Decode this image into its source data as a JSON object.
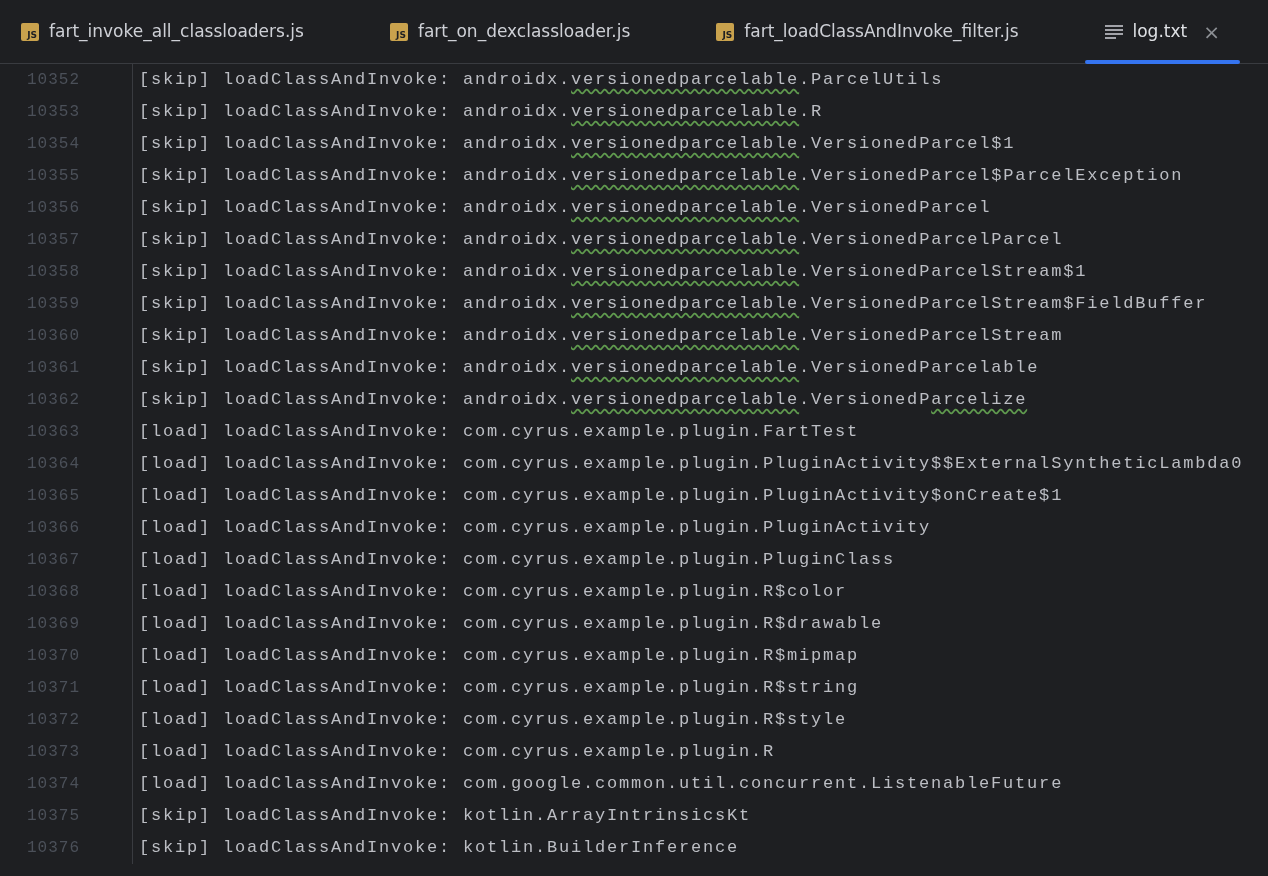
{
  "tabs": [
    {
      "kind": "js",
      "icon_label": "JS",
      "label": "fart_invoke_all_classloaders.js",
      "selected": false
    },
    {
      "kind": "js",
      "icon_label": "JS",
      "label": "fart_on_dexclassloader.js",
      "selected": false
    },
    {
      "kind": "js",
      "icon_label": "JS",
      "label": "fart_loadClassAndInvoke_filter.js",
      "selected": false
    },
    {
      "kind": "text",
      "label": "log.txt",
      "selected": true,
      "close": "×"
    }
  ],
  "lines": [
    {
      "number": "10352",
      "segments": [
        {
          "kind": "plain",
          "text": "[skip] loadClassAndInvoke: androidx."
        },
        {
          "kind": "typo",
          "text": "versionedparcelable"
        },
        {
          "kind": "plain",
          "text": ".ParcelUtils"
        }
      ]
    },
    {
      "number": "10353",
      "segments": [
        {
          "kind": "plain",
          "text": "[skip] loadClassAndInvoke: androidx."
        },
        {
          "kind": "typo",
          "text": "versionedparcelable"
        },
        {
          "kind": "plain",
          "text": ".R"
        }
      ]
    },
    {
      "number": "10354",
      "segments": [
        {
          "kind": "plain",
          "text": "[skip] loadClassAndInvoke: androidx."
        },
        {
          "kind": "typo",
          "text": "versionedparcelable"
        },
        {
          "kind": "plain",
          "text": ".VersionedParcel$1"
        }
      ]
    },
    {
      "number": "10355",
      "segments": [
        {
          "kind": "plain",
          "text": "[skip] loadClassAndInvoke: androidx."
        },
        {
          "kind": "typo",
          "text": "versionedparcelable"
        },
        {
          "kind": "plain",
          "text": ".VersionedParcel$ParcelException"
        }
      ]
    },
    {
      "number": "10356",
      "segments": [
        {
          "kind": "plain",
          "text": "[skip] loadClassAndInvoke: androidx."
        },
        {
          "kind": "typo",
          "text": "versionedparcelable"
        },
        {
          "kind": "plain",
          "text": ".VersionedParcel"
        }
      ]
    },
    {
      "number": "10357",
      "segments": [
        {
          "kind": "plain",
          "text": "[skip] loadClassAndInvoke: androidx."
        },
        {
          "kind": "typo",
          "text": "versionedparcelable"
        },
        {
          "kind": "plain",
          "text": ".VersionedParcelParcel"
        }
      ]
    },
    {
      "number": "10358",
      "segments": [
        {
          "kind": "plain",
          "text": "[skip] loadClassAndInvoke: androidx."
        },
        {
          "kind": "typo",
          "text": "versionedparcelable"
        },
        {
          "kind": "plain",
          "text": ".VersionedParcelStream$1"
        }
      ]
    },
    {
      "number": "10359",
      "segments": [
        {
          "kind": "plain",
          "text": "[skip] loadClassAndInvoke: androidx."
        },
        {
          "kind": "typo",
          "text": "versionedparcelable"
        },
        {
          "kind": "plain",
          "text": ".VersionedParcelStream$FieldBuffer"
        }
      ]
    },
    {
      "number": "10360",
      "segments": [
        {
          "kind": "plain",
          "text": "[skip] loadClassAndInvoke: androidx."
        },
        {
          "kind": "typo",
          "text": "versionedparcelable"
        },
        {
          "kind": "plain",
          "text": ".VersionedParcelStream"
        }
      ]
    },
    {
      "number": "10361",
      "segments": [
        {
          "kind": "plain",
          "text": "[skip] loadClassAndInvoke: androidx."
        },
        {
          "kind": "typo",
          "text": "versionedparcelable"
        },
        {
          "kind": "plain",
          "text": ".VersionedParcelable"
        }
      ]
    },
    {
      "number": "10362",
      "segments": [
        {
          "kind": "plain",
          "text": "[skip] loadClassAndInvoke: androidx."
        },
        {
          "kind": "typo",
          "text": "versionedparcelable"
        },
        {
          "kind": "plain",
          "text": ".VersionedP"
        },
        {
          "kind": "typo",
          "text": "arcelize"
        }
      ]
    },
    {
      "number": "10363",
      "segments": [
        {
          "kind": "plain",
          "text": "[load] loadClassAndInvoke: com.cyrus.example.plugin.FartTest"
        }
      ]
    },
    {
      "number": "10364",
      "segments": [
        {
          "kind": "plain",
          "text": "[load] loadClassAndInvoke: com.cyrus.example.plugin.PluginActivity$$ExternalSyntheticLambda0"
        }
      ]
    },
    {
      "number": "10365",
      "segments": [
        {
          "kind": "plain",
          "text": "[load] loadClassAndInvoke: com.cyrus.example.plugin.PluginActivity$onCreate$1"
        }
      ]
    },
    {
      "number": "10366",
      "segments": [
        {
          "kind": "plain",
          "text": "[load] loadClassAndInvoke: com.cyrus.example.plugin.PluginActivity"
        }
      ]
    },
    {
      "number": "10367",
      "segments": [
        {
          "kind": "plain",
          "text": "[load] loadClassAndInvoke: com.cyrus.example.plugin.PluginClass"
        }
      ]
    },
    {
      "number": "10368",
      "segments": [
        {
          "kind": "plain",
          "text": "[load] loadClassAndInvoke: com.cyrus.example.plugin.R$color"
        }
      ]
    },
    {
      "number": "10369",
      "segments": [
        {
          "kind": "plain",
          "text": "[load] loadClassAndInvoke: com.cyrus.example.plugin.R$drawable"
        }
      ]
    },
    {
      "number": "10370",
      "segments": [
        {
          "kind": "plain",
          "text": "[load] loadClassAndInvoke: com.cyrus.example.plugin.R$mipmap"
        }
      ]
    },
    {
      "number": "10371",
      "segments": [
        {
          "kind": "plain",
          "text": "[load] loadClassAndInvoke: com.cyrus.example.plugin.R$string"
        }
      ]
    },
    {
      "number": "10372",
      "segments": [
        {
          "kind": "plain",
          "text": "[load] loadClassAndInvoke: com.cyrus.example.plugin.R$style"
        }
      ]
    },
    {
      "number": "10373",
      "segments": [
        {
          "kind": "plain",
          "text": "[load] loadClassAndInvoke: com.cyrus.example.plugin.R"
        }
      ]
    },
    {
      "number": "10374",
      "segments": [
        {
          "kind": "plain",
          "text": "[load] loadClassAndInvoke: com.google.common.util.concurrent.ListenableFuture"
        }
      ]
    },
    {
      "number": "10375",
      "segments": [
        {
          "kind": "plain",
          "text": "[skip] loadClassAndInvoke: kotlin.ArrayIntrinsicsKt"
        }
      ]
    },
    {
      "number": "10376",
      "segments": [
        {
          "kind": "plain",
          "text": "[skip] loadClassAndInvoke: kotlin.BuilderInference"
        }
      ]
    }
  ]
}
